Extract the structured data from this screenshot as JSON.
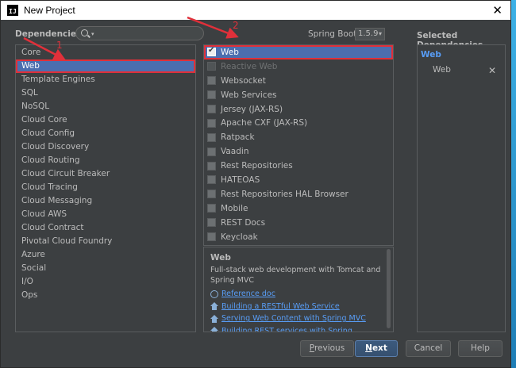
{
  "window": {
    "title": "New Project",
    "icon_text": "IJ",
    "close_glyph": "✕"
  },
  "header": {
    "dependencies_label": "Dependencies",
    "search_placeholder": "",
    "spring_boot_label": "Spring Boot",
    "spring_boot_version": "1.5.9",
    "selected_label": "Selected Dependencies"
  },
  "categories": [
    {
      "label": "Core"
    },
    {
      "label": "Web"
    },
    {
      "label": "Template Engines"
    },
    {
      "label": "SQL"
    },
    {
      "label": "NoSQL"
    },
    {
      "label": "Cloud Core"
    },
    {
      "label": "Cloud Config"
    },
    {
      "label": "Cloud Discovery"
    },
    {
      "label": "Cloud Routing"
    },
    {
      "label": "Cloud Circuit Breaker"
    },
    {
      "label": "Cloud Tracing"
    },
    {
      "label": "Cloud Messaging"
    },
    {
      "label": "Cloud AWS"
    },
    {
      "label": "Cloud Contract"
    },
    {
      "label": "Pivotal Cloud Foundry"
    },
    {
      "label": "Azure"
    },
    {
      "label": "Social"
    },
    {
      "label": "I/O"
    },
    {
      "label": "Ops"
    }
  ],
  "selected_category": "Web",
  "dependencies": [
    {
      "label": "Web",
      "checked": true,
      "enabled": true
    },
    {
      "label": "Reactive Web",
      "checked": false,
      "enabled": false
    },
    {
      "label": "Websocket",
      "checked": false,
      "enabled": true
    },
    {
      "label": "Web Services",
      "checked": false,
      "enabled": true
    },
    {
      "label": "Jersey (JAX-RS)",
      "checked": false,
      "enabled": true
    },
    {
      "label": "Apache CXF (JAX-RS)",
      "checked": false,
      "enabled": true
    },
    {
      "label": "Ratpack",
      "checked": false,
      "enabled": true
    },
    {
      "label": "Vaadin",
      "checked": false,
      "enabled": true
    },
    {
      "label": "Rest Repositories",
      "checked": false,
      "enabled": true
    },
    {
      "label": "HATEOAS",
      "checked": false,
      "enabled": true
    },
    {
      "label": "Rest Repositories HAL Browser",
      "checked": false,
      "enabled": true
    },
    {
      "label": "Mobile",
      "checked": false,
      "enabled": true
    },
    {
      "label": "REST Docs",
      "checked": false,
      "enabled": true
    },
    {
      "label": "Keycloak",
      "checked": false,
      "enabled": true
    }
  ],
  "description": {
    "title": "Web",
    "text": "Full-stack web development with Tomcat and Spring MVC",
    "links": [
      {
        "label": "Reference doc",
        "icon": "reference-doc-icon"
      },
      {
        "label": "Building a RESTful Web Service",
        "icon": "guide-home-icon"
      },
      {
        "label": "Serving Web Content with Spring MVC",
        "icon": "guide-home-icon"
      },
      {
        "label": "Building REST services with Spring",
        "icon": "guide-home-icon"
      }
    ]
  },
  "selected": {
    "group": "Web",
    "items": [
      {
        "label": "Web",
        "remove_glyph": "✕"
      }
    ]
  },
  "buttons": {
    "previous": {
      "prefix": "",
      "mnemonic": "P",
      "rest": "revious"
    },
    "next": {
      "prefix": "",
      "mnemonic": "N",
      "rest": "ext"
    },
    "cancel": "Cancel",
    "help": "Help"
  },
  "annotations": {
    "marker1": "1",
    "marker2": "2",
    "color": "#e0303a"
  },
  "colors": {
    "selection": "#4b6eaf",
    "link": "#589df6",
    "panel": "#3c3f41"
  }
}
